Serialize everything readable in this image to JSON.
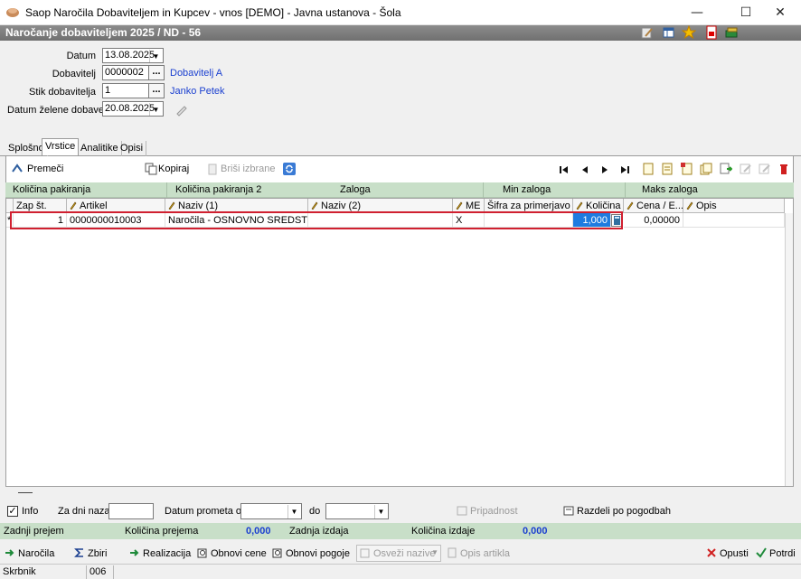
{
  "window": {
    "title": "Saop  Naročila Dobaviteljem in Kupcev - vnos [DEMO] - Javna ustanova - Šola",
    "min_glyph": "—",
    "max_glyph": "☐",
    "close_glyph": "✕"
  },
  "header": {
    "form_title": "Naročanje dobaviteljem 2025 / ND - 56",
    "icons": [
      "edit-note-icon",
      "grid-settings-icon",
      "favorite-star-icon",
      "pdf-export-icon",
      "help-books-icon"
    ]
  },
  "form": {
    "datum_label": "Datum",
    "datum_value": "13.08.2025",
    "dobavitelj_label": "Dobavitelj",
    "dobavitelj_value": "0000002",
    "dobavitelj_name": "Dobavitelj A",
    "stik_label": "Stik dobavitelja",
    "stik_value": "1",
    "stik_name": "Janko Petek",
    "datum_dobave_label": "Datum želene dobave",
    "datum_dobave_value": "20.08.2025",
    "ellipsis": "..."
  },
  "tabs": [
    "Splošno",
    "Vrstice",
    "Analitike",
    "Opisi"
  ],
  "toolbar": {
    "premeci": "Premeči",
    "kopiraj": "Kopiraj",
    "brisi": "Briši izbrane"
  },
  "groups": {
    "kolicina_pakiranja": "Količina pakiranja",
    "kolicina_pakiranja_2": "Količina pakiranja 2",
    "zaloga": "Zaloga",
    "min_zaloga": "Min zaloga",
    "maks_zaloga": "Maks zaloga"
  },
  "grid": {
    "columns": [
      "Zap št.",
      "Artikel",
      "Naziv (1)",
      "Naziv (2)",
      "ME",
      "Šifra za primerjavo",
      "Količina",
      "Cena / E...",
      "Opis"
    ],
    "rows": [
      {
        "marker": "*",
        "zap_st": "1",
        "artikel": "0000000010003",
        "naziv1": "Naročila - OSNOVNO SREDSTVO",
        "naziv2": "",
        "me": "X",
        "sifra": "",
        "kolicina": "1,000",
        "cena": "0,00000",
        "opis": ""
      }
    ]
  },
  "filters": {
    "info_label": "Info",
    "info_checked": "✓",
    "za_dni_nazaj_label": "Za dni nazaj",
    "datum_prometa_od_label": "Datum prometa od",
    "do_label": "do",
    "pripadnost": "Pripadnost",
    "razdeli": "Razdeli po pogodbah"
  },
  "summary": {
    "zadnji_prejem_label": "Zadnji prejem",
    "kolicina_prejema_label": "Količina prejema",
    "kolicina_prejema_value": "0,000",
    "zadnja_izdaja_label": "Zadnja izdaja",
    "kolicina_izdaje_label": "Količina izdaje",
    "kolicina_izdaje_value": "0,000"
  },
  "bottom_buttons": {
    "narocila": "Naročila",
    "zbiri": "Zbiri",
    "realizacija": "Realizacija",
    "obnovi_cene": "Obnovi cene",
    "obnovi_pogoje": "Obnovi pogoje",
    "osvezi_nazive": "Osveži nazive",
    "opis_artikla": "Opis artikla",
    "opusti": "Opusti",
    "potrdi": "Potrdi"
  },
  "statusbar": {
    "user": "Skrbnik",
    "code": "006"
  },
  "colors": {
    "group_band": "#c8dfc8",
    "header_band": "#7f7f7f",
    "link_blue": "#1a3fd0",
    "selected_cell": "#1e7be0",
    "row_highlight": "#d02030"
  }
}
